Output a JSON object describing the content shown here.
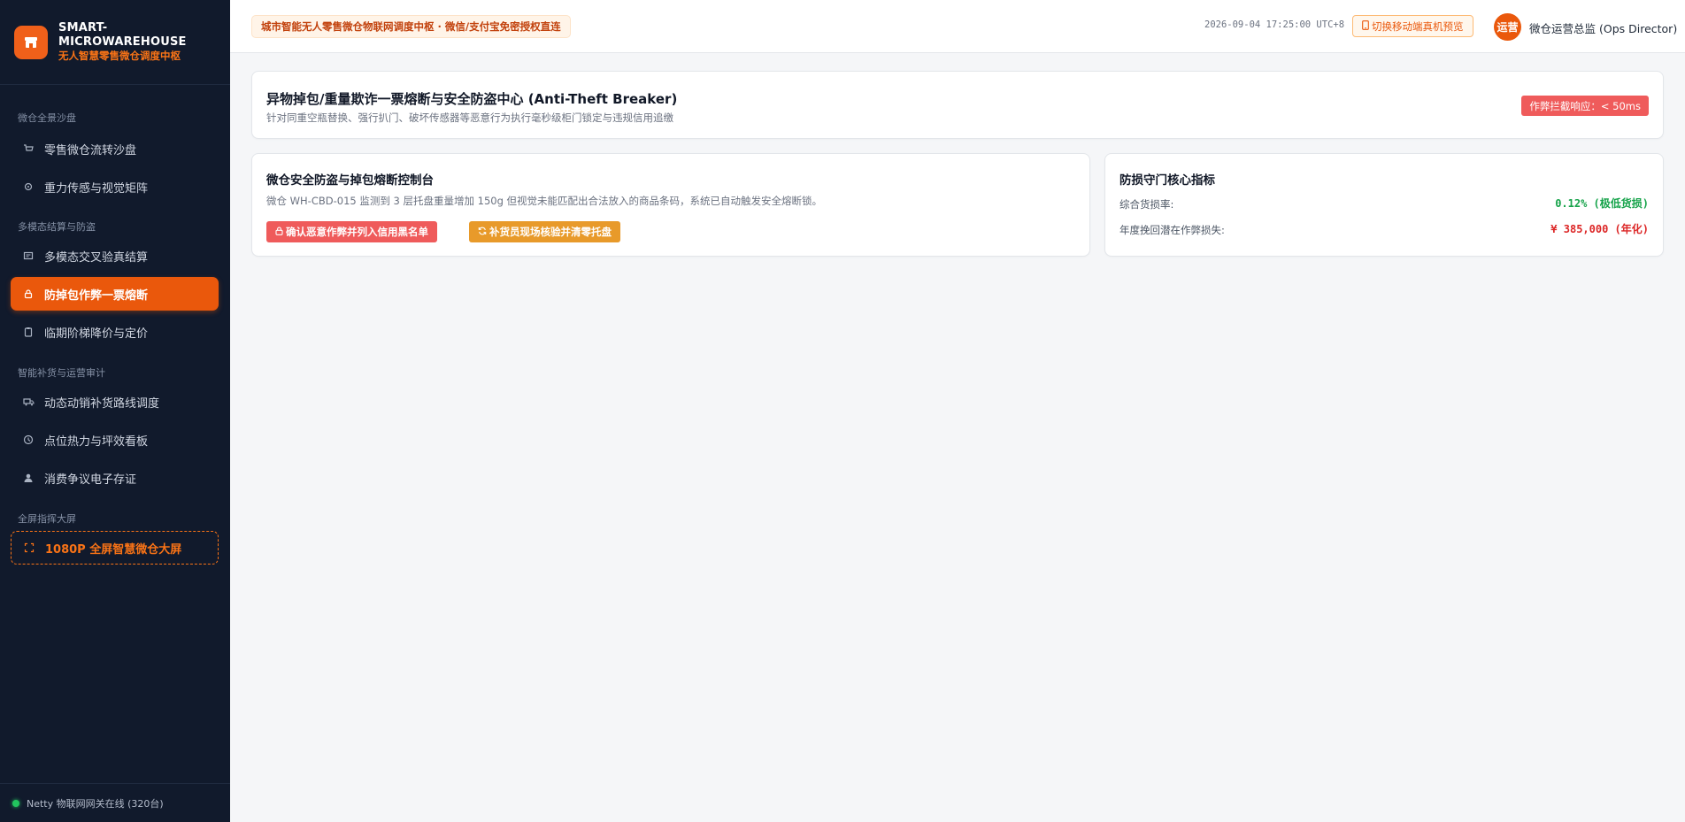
{
  "brand": {
    "title": "SMART-MICROWAREHOUSE",
    "subtitle": "无人智慧零售微仓调度中枢",
    "logo_icon": "shop-icon",
    "accent_color": "#ea580c"
  },
  "sidebar": {
    "groups": [
      {
        "label": "微仓全景沙盘",
        "items": [
          {
            "label": "零售微仓流转沙盘",
            "icon": "cart-icon"
          },
          {
            "label": "重力传感与视觉矩阵",
            "icon": "chip-icon"
          }
        ]
      },
      {
        "label": "多模态结算与防盗",
        "items": [
          {
            "label": "多模态交叉验真结算",
            "icon": "settlement-icon"
          },
          {
            "label": "防掉包作弊一票熔断",
            "icon": "lock-icon",
            "active": true
          },
          {
            "label": "临期阶梯降价与定价",
            "icon": "clipboard-icon"
          }
        ]
      },
      {
        "label": "智能补货与运营审计",
        "items": [
          {
            "label": "动态动销补货路线调度",
            "icon": "truck-icon"
          },
          {
            "label": "点位热力与坪效看板",
            "icon": "clock-icon"
          },
          {
            "label": "消费争议电子存证",
            "icon": "user-icon"
          }
        ]
      },
      {
        "label": "全屏指挥大屏",
        "items": [
          {
            "label": "1080P 全屏智慧微仓大屏",
            "icon": "fullscreen-icon"
          }
        ]
      }
    ],
    "footer_status": "Netty 物联网网关在线 (320台)",
    "footer_status_color": "#22c55e"
  },
  "topbar": {
    "banner": "城市智能无人零售微仓物联网调度中枢 · 微信/支付宝免密授权直连",
    "datetime": "2026-09-04 17:25:00 UTC+8",
    "mobile_preview_button": "切换移动端真机预览",
    "avatar_text": "运营",
    "user_name": "微仓运营总监 (Ops Director)"
  },
  "header": {
    "title": "异物掉包/重量欺诈一票熔断与安全防盗中心 (Anti-Theft Breaker)",
    "subtitle": "针对同重空瓶替换、强行扒门、破坏传感器等恶意行为执行毫秒级柜门锁定与违规信用追缴",
    "badge": "作弊拦截响应：< 50ms"
  },
  "control": {
    "title": "微仓安全防盗与掉包熔断控制台",
    "description": "微仓 WH-CBD-015 监测到 3 层托盘重量增加 150g 但视觉未能匹配出合法放入的商品条码，系统已自动触发安全熔断锁。",
    "confirm_button": "确认恶意作弊并列入信用黑名单",
    "verify_button": "补货员现场核验并清零托盘"
  },
  "metrics": {
    "title": "防损守门核心指标",
    "rows": [
      {
        "label": "综合货损率:",
        "value": "0.12% (极低货损)",
        "color": "#16a34a"
      },
      {
        "label": "年度挽回潜在作弊损失:",
        "value": "¥ 385,000 (年化)",
        "color": "#dc2626"
      }
    ]
  }
}
